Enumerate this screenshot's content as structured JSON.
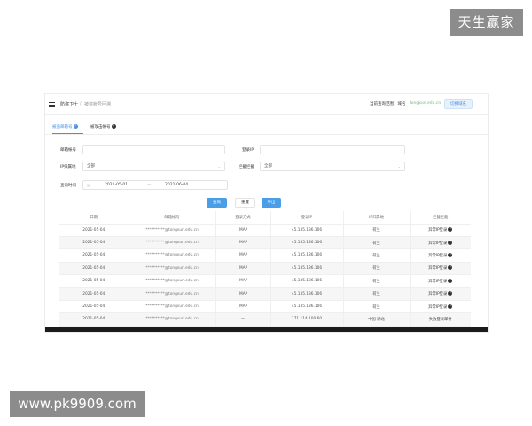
{
  "watermarks": {
    "top_right": "天生赢家",
    "bottom_left": "www.pk9909.com"
  },
  "header": {
    "breadcrumb_root": "防盗卫士",
    "breadcrumb_current": "被盗帐号回溯",
    "domain_label": "当前查询范围：域名",
    "domain_value": "tongxun.edu.cn",
    "switch_button": "切换域名"
  },
  "tabs": [
    {
      "label": "被盗邮箱号",
      "info": "?"
    },
    {
      "label": "被攻击帐号",
      "info": "?"
    }
  ],
  "filters": {
    "account_label": "邮箱帐号",
    "account_value": "",
    "login_ip_label": "登录IP",
    "login_ip_value": "",
    "ip_region_label": "IP归属地",
    "ip_region_value": "全部",
    "block_label": "拦截拦截",
    "block_value": "全部",
    "time_label": "查询时间",
    "start_date": "2021-05-01",
    "date_separator": "—",
    "end_date": "2021-06-04"
  },
  "buttons": {
    "query": "查询",
    "reset": "重置",
    "export": "导出"
  },
  "table": {
    "headers": [
      "日期",
      "邮箱帐号",
      "登录方式",
      "登录IP",
      "IP归属地",
      "拦截拦截"
    ],
    "rows": [
      {
        "date": "2021-05-04",
        "account": "**********@tongxun.edu.cn",
        "method": "IMAP",
        "ip": "45.135.186.106",
        "region": "荷兰",
        "action": "异常IP登录"
      },
      {
        "date": "2021-05-04",
        "account": "**********@tongxun.edu.cn",
        "method": "IMAP",
        "ip": "45.135.186.106",
        "region": "荷兰",
        "action": "异常IP登录"
      },
      {
        "date": "2021-05-04",
        "account": "**********@tongxun.edu.cn",
        "method": "IMAP",
        "ip": "45.135.186.106",
        "region": "荷兰",
        "action": "异常IP登录"
      },
      {
        "date": "2021-05-04",
        "account": "**********@tongxun.edu.cn",
        "method": "IMAP",
        "ip": "45.135.186.106",
        "region": "荷兰",
        "action": "异常IP登录"
      },
      {
        "date": "2021-05-04",
        "account": "**********@tongxun.edu.cn",
        "method": "IMAP",
        "ip": "45.135.186.106",
        "region": "荷兰",
        "action": "异常IP登录"
      },
      {
        "date": "2021-05-04",
        "account": "**********@tongxun.edu.cn",
        "method": "IMAP",
        "ip": "45.135.186.106",
        "region": "荷兰",
        "action": "异常IP登录"
      },
      {
        "date": "2021-05-04",
        "account": "**********@tongxun.edu.cn",
        "method": "IMAP",
        "ip": "45.135.186.106",
        "region": "荷兰",
        "action": "异常IP登录"
      },
      {
        "date": "2021-05-04",
        "account": "**********@tongxun.edu.cn",
        "method": "—",
        "ip": "171.114.100.60",
        "region": "中国 湖北",
        "action": "失败登录邮件"
      }
    ]
  },
  "icons": {
    "menu": "hamburger-icon",
    "info": "info-icon",
    "question": "question-icon",
    "calendar": "calendar-icon",
    "dropdown": "chevron-down-icon"
  },
  "colors": {
    "accent": "#4a9ee8",
    "domain_text": "#6cbf7a"
  }
}
